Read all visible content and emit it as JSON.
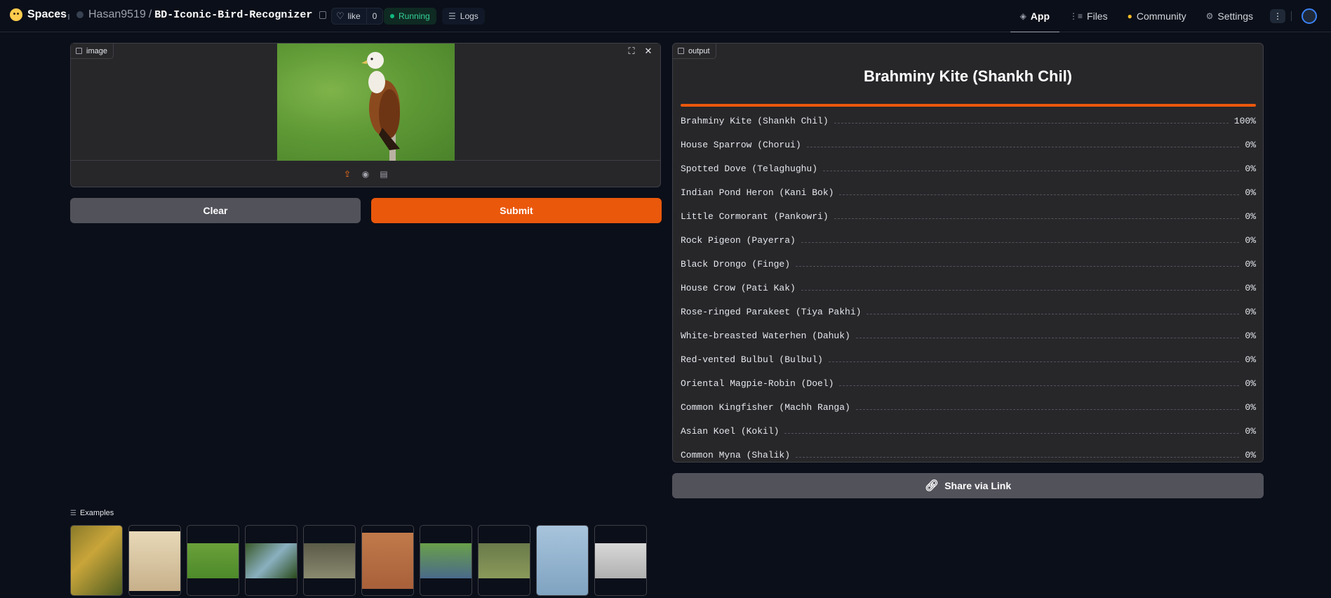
{
  "topbar": {
    "brand": "Spaces",
    "owner": "Hasan9519",
    "slash": "/",
    "repo": "BD-Iconic-Bird-Recognizer",
    "like_label": "like",
    "like_count": "0",
    "status": "Running",
    "logs": "Logs",
    "nav": [
      {
        "label": "App",
        "icon": "cube-icon",
        "active": true
      },
      {
        "label": "Files",
        "icon": "files-icon",
        "active": false
      },
      {
        "label": "Community",
        "icon": "community-icon",
        "active": false
      },
      {
        "label": "Settings",
        "icon": "gear-icon",
        "active": false
      }
    ]
  },
  "input": {
    "label": "image"
  },
  "buttons": {
    "clear": "Clear",
    "submit": "Submit",
    "share": "Share via Link"
  },
  "output": {
    "label": "output",
    "title": "Brahminy Kite (Shankh Chil)",
    "top_confidence": 1.0,
    "confidences": [
      {
        "label": "Brahminy Kite (Shankh Chil)",
        "pct": "100%"
      },
      {
        "label": "House Sparrow (Chorui)",
        "pct": "0%"
      },
      {
        "label": "Spotted Dove (Telaghughu)",
        "pct": "0%"
      },
      {
        "label": "Indian Pond Heron (Kani Bok)",
        "pct": "0%"
      },
      {
        "label": "Little Cormorant (Pankowri)",
        "pct": "0%"
      },
      {
        "label": "Rock Pigeon (Payerra)",
        "pct": "0%"
      },
      {
        "label": "Black Drongo (Finge)",
        "pct": "0%"
      },
      {
        "label": "House Crow (Pati Kak)",
        "pct": "0%"
      },
      {
        "label": "Rose-ringed Parakeet (Tiya Pakhi)",
        "pct": "0%"
      },
      {
        "label": "White-breasted Waterhen (Dahuk)",
        "pct": "0%"
      },
      {
        "label": "Red-vented Bulbul (Bulbul)",
        "pct": "0%"
      },
      {
        "label": "Oriental Magpie-Robin (Doel)",
        "pct": "0%"
      },
      {
        "label": "Common Kingfisher (Machh Ranga)",
        "pct": "0%"
      },
      {
        "label": "Asian Koel (Kokil)",
        "pct": "0%"
      },
      {
        "label": "Common Myna (Shalik)",
        "pct": "0%"
      }
    ]
  },
  "examples": {
    "label": "Examples",
    "items": [
      "koel",
      "drongo",
      "kite",
      "kingfisher",
      "myna",
      "crow",
      "sparrow",
      "heron",
      "cormorant",
      "magpie-robin"
    ]
  },
  "colors": {
    "accent": "#ea580c",
    "running": "#34d399",
    "background": "#0b0f19",
    "panel": "#27272a"
  }
}
